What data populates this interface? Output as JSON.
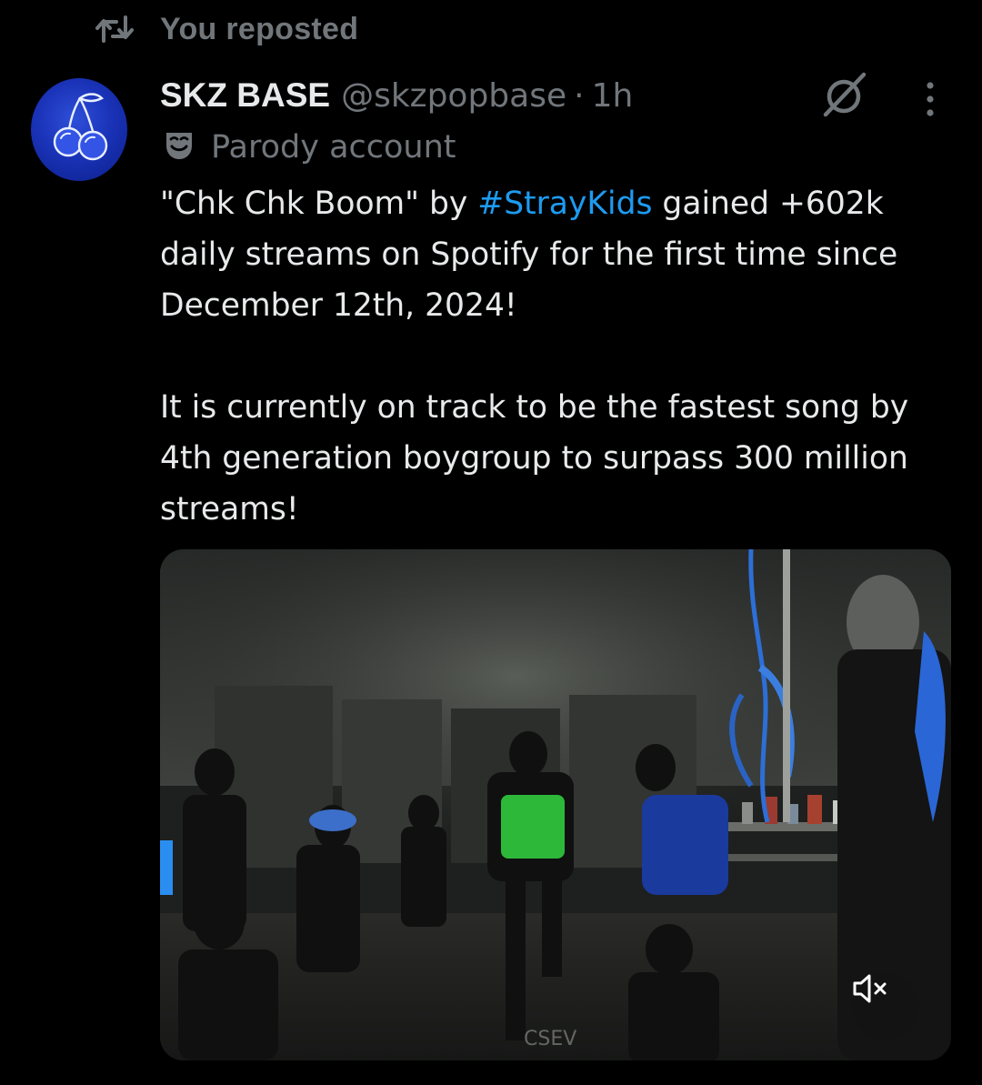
{
  "repost": {
    "label": "You reposted",
    "icon": "repost-icon"
  },
  "author": {
    "display_name": "SKZ BASE",
    "handle": "@skzpopbase",
    "separator": "·",
    "time": "1h",
    "avatar_icon": "cherry-icon",
    "avatar_color": "#1a33b8",
    "parody_icon": "theater-mask-icon",
    "parody_label": "Parody account"
  },
  "actions": {
    "grok_icon": "grok-icon",
    "more_icon": "more-options-icon"
  },
  "tweet": {
    "line1_before": "\"Chk Chk Boom\" by ",
    "hashtag": "#StrayKids",
    "line1_after": " gained +602k daily streams on Spotify for the first time since December 12th, 2024!",
    "paragraph2": "It is currently on track to be the fastest song by 4th generation boygroup to surpass 300 million streams!",
    "hashtag_color": "#1d9bf0"
  },
  "media": {
    "type": "video",
    "mute_icon": "volume-muted-icon",
    "watermark": "CSEV"
  },
  "colors": {
    "background": "#000000",
    "primary_text": "#e7e9ea",
    "secondary_text": "#71767b",
    "link": "#1d9bf0"
  }
}
